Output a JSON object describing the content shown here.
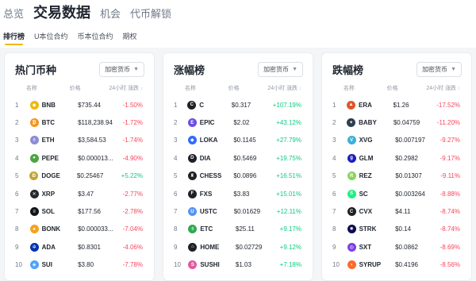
{
  "topnav": {
    "items": [
      "总览",
      "交易数据",
      "机会",
      "代币解锁"
    ],
    "active": 1
  },
  "subnav": {
    "items": [
      "排行榜",
      "U本位合约",
      "币本位合约",
      "期权"
    ],
    "active": 0
  },
  "columns": {
    "name": "名称",
    "price": "价格",
    "change": "24小时 涨跌",
    "sort_icon": "↕"
  },
  "panels": [
    {
      "title": "热门币种",
      "filter": "加密货币",
      "rows": [
        {
          "rank": "1",
          "symbol": "BNB",
          "price": "$735.44",
          "change": "-1.50%",
          "dir": "down",
          "icon": "bnb-icon",
          "color": "#f0b90b",
          "glyph": "◆"
        },
        {
          "rank": "2",
          "symbol": "BTC",
          "price": "$118,238.94",
          "change": "-1.72%",
          "dir": "down",
          "icon": "btc-icon",
          "color": "#f7931a",
          "glyph": "₿"
        },
        {
          "rank": "3",
          "symbol": "ETH",
          "price": "$3,584.53",
          "change": "-1.74%",
          "dir": "down",
          "icon": "eth-icon",
          "color": "#8c8cd9",
          "glyph": "◊"
        },
        {
          "rank": "4",
          "symbol": "PEPE",
          "price": "$0.000013...",
          "change": "-4.90%",
          "dir": "down",
          "icon": "pepe-icon",
          "color": "#4ca543",
          "glyph": "●"
        },
        {
          "rank": "5",
          "symbol": "DOGE",
          "price": "$0.25467",
          "change": "+5.22%",
          "dir": "up",
          "icon": "doge-icon",
          "color": "#c2a633",
          "glyph": "Ð"
        },
        {
          "rank": "6",
          "symbol": "XRP",
          "price": "$3.47",
          "change": "-2.77%",
          "dir": "down",
          "icon": "xrp-icon",
          "color": "#23292f",
          "glyph": "✕"
        },
        {
          "rank": "7",
          "symbol": "SOL",
          "price": "$177.56",
          "change": "-2.78%",
          "dir": "down",
          "icon": "sol-icon",
          "color": "#14151a",
          "glyph": "≡"
        },
        {
          "rank": "8",
          "symbol": "BONK",
          "price": "$0.000033...",
          "change": "-7.04%",
          "dir": "down",
          "icon": "bonk-icon",
          "color": "#f8a11c",
          "glyph": "●"
        },
        {
          "rank": "9",
          "symbol": "ADA",
          "price": "$0.8301",
          "change": "-4.06%",
          "dir": "down",
          "icon": "ada-icon",
          "color": "#0033ad",
          "glyph": "✲"
        },
        {
          "rank": "10",
          "symbol": "SUI",
          "price": "$3.80",
          "change": "-7.78%",
          "dir": "down",
          "icon": "sui-icon",
          "color": "#4da2ff",
          "glyph": "◈"
        }
      ]
    },
    {
      "title": "涨幅榜",
      "filter": "加密货币",
      "rows": [
        {
          "rank": "1",
          "symbol": "C",
          "price": "$0.317",
          "change": "+107.19%",
          "dir": "up",
          "icon": "c-icon",
          "color": "#1e2026",
          "glyph": "C"
        },
        {
          "rank": "2",
          "symbol": "EPIC",
          "price": "$2.02",
          "change": "+43.12%",
          "dir": "up",
          "icon": "epic-icon",
          "color": "#6b4de6",
          "glyph": "E"
        },
        {
          "rank": "3",
          "symbol": "LOKA",
          "price": "$0.1145",
          "change": "+27.79%",
          "dir": "up",
          "icon": "loka-icon",
          "color": "#2f6bff",
          "glyph": "◆"
        },
        {
          "rank": "4",
          "symbol": "DIA",
          "price": "$0.5469",
          "change": "+19.75%",
          "dir": "up",
          "icon": "dia-icon",
          "color": "#1e2026",
          "glyph": "D"
        },
        {
          "rank": "5",
          "symbol": "CHESS",
          "price": "$0.0896",
          "change": "+16.51%",
          "dir": "up",
          "icon": "chess-icon",
          "color": "#1e2026",
          "glyph": "♜"
        },
        {
          "rank": "6",
          "symbol": "FXS",
          "price": "$3.83",
          "change": "+15.01%",
          "dir": "up",
          "icon": "fxs-icon",
          "color": "#1e2026",
          "glyph": "F"
        },
        {
          "rank": "7",
          "symbol": "USTC",
          "price": "$0.01629",
          "change": "+12.11%",
          "dir": "up",
          "icon": "ustc-icon",
          "color": "#5493f7",
          "glyph": "U"
        },
        {
          "rank": "8",
          "symbol": "ETC",
          "price": "$25.11",
          "change": "+9.17%",
          "dir": "up",
          "icon": "etc-icon",
          "color": "#34a853",
          "glyph": "◊"
        },
        {
          "rank": "9",
          "symbol": "HOME",
          "price": "$0.02729",
          "change": "+9.12%",
          "dir": "up",
          "icon": "home-icon",
          "color": "#1e2026",
          "glyph": "⌂"
        },
        {
          "rank": "10",
          "symbol": "SUSHI",
          "price": "$1.03",
          "change": "+7.18%",
          "dir": "up",
          "icon": "sushi-icon",
          "color": "#e05aa0",
          "glyph": "S"
        }
      ]
    },
    {
      "title": "跌幅榜",
      "filter": "加密货币",
      "rows": [
        {
          "rank": "1",
          "symbol": "ERA",
          "price": "$1.26",
          "change": "-17.52%",
          "dir": "down",
          "icon": "era-icon",
          "color": "#e0562b",
          "glyph": "▲"
        },
        {
          "rank": "2",
          "symbol": "BABY",
          "price": "$0.04759",
          "change": "-11.20%",
          "dir": "down",
          "icon": "baby-icon",
          "color": "#2c3e50",
          "glyph": "✦"
        },
        {
          "rank": "3",
          "symbol": "XVG",
          "price": "$0.007197",
          "change": "-9.27%",
          "dir": "down",
          "icon": "xvg-icon",
          "color": "#3bb0d9",
          "glyph": "V"
        },
        {
          "rank": "4",
          "symbol": "GLM",
          "price": "$0.2982",
          "change": "-9.17%",
          "dir": "down",
          "icon": "glm-icon",
          "color": "#1c1cbf",
          "glyph": "g"
        },
        {
          "rank": "5",
          "symbol": "REZ",
          "price": "$0.01307",
          "change": "-9.11%",
          "dir": "down",
          "icon": "rez-icon",
          "color": "#8bd35a",
          "glyph": "R"
        },
        {
          "rank": "6",
          "symbol": "SC",
          "price": "$0.003264",
          "change": "-8.88%",
          "dir": "down",
          "icon": "sc-icon",
          "color": "#20ee82",
          "glyph": "S"
        },
        {
          "rank": "7",
          "symbol": "CVX",
          "price": "$4.11",
          "change": "-8.74%",
          "dir": "down",
          "icon": "cvx-icon",
          "color": "#1e2026",
          "glyph": "C"
        },
        {
          "rank": "8",
          "symbol": "STRK",
          "price": "$0.14",
          "change": "-8.74%",
          "dir": "down",
          "icon": "strk-icon",
          "color": "#0c0c4f",
          "glyph": "✸"
        },
        {
          "rank": "9",
          "symbol": "SXT",
          "price": "$0.0862",
          "change": "-8.69%",
          "dir": "down",
          "icon": "sxt-icon",
          "color": "#7b3fe4",
          "glyph": "◎"
        },
        {
          "rank": "10",
          "symbol": "SYRUP",
          "price": "$0.4196",
          "change": "-8.56%",
          "dir": "down",
          "icon": "syrup-icon",
          "color": "#ff6a2b",
          "glyph": "◖"
        }
      ]
    }
  ],
  "colors": {
    "up": "#0ecb81",
    "down": "#f6465d",
    "accent": "#f0b90b"
  }
}
